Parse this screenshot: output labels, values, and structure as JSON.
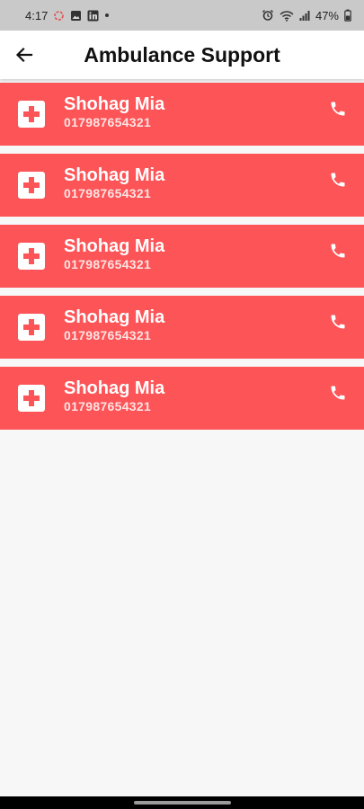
{
  "status_bar": {
    "time": "4:17",
    "battery": "47%",
    "icons": [
      "notification-ring-icon",
      "gallery-icon",
      "linkedin-icon",
      "dot-icon",
      "alarm-icon",
      "wifi-icon",
      "signal-icon",
      "battery-icon"
    ]
  },
  "app_bar": {
    "title": "Ambulance Support",
    "back_icon": "arrow-left-icon"
  },
  "contacts": [
    {
      "name": "Shohag Mia",
      "phone": "017987654321"
    },
    {
      "name": "Shohag Mia",
      "phone": "017987654321"
    },
    {
      "name": "Shohag Mia",
      "phone": "017987654321"
    },
    {
      "name": "Shohag Mia",
      "phone": "017987654321"
    },
    {
      "name": "Shohag Mia",
      "phone": "017987654321"
    }
  ],
  "colors": {
    "card_background": "#fc5457",
    "page_background": "#f7f7f7",
    "status_bar": "#c9c9c9"
  }
}
